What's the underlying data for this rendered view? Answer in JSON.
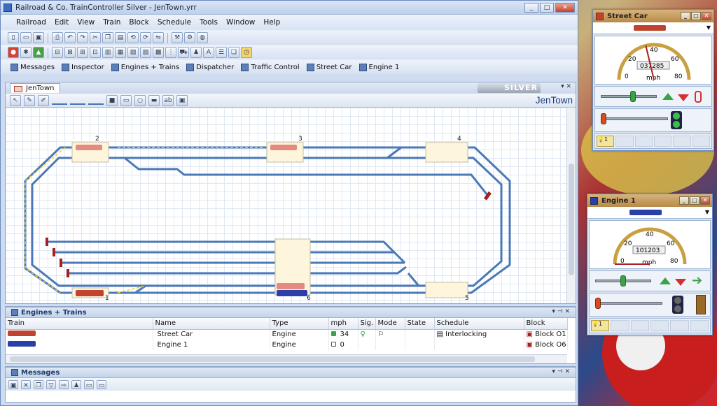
{
  "window": {
    "title": "Railroad & Co. TrainController Silver - JenTown.yrr"
  },
  "menu": [
    "Railroad",
    "Edit",
    "View",
    "Train",
    "Block",
    "Schedule",
    "Tools",
    "Window",
    "Help"
  ],
  "quick_access": [
    "Messages",
    "Inspector",
    "Engines + Trains",
    "Dispatcher",
    "Traffic Control",
    "Street Car",
    "Engine 1"
  ],
  "document": {
    "tab": "JenTown",
    "edition_badge": "SILVER",
    "layout_title": "JenTown",
    "block_labels": [
      "2",
      "3",
      "4",
      "1",
      "6",
      "5"
    ]
  },
  "engines_pane": {
    "title": "Engines + Trains",
    "columns": [
      "Train",
      "Name",
      "Type",
      "mph",
      "Sig.",
      "Mode",
      "State",
      "Schedule",
      "Block"
    ],
    "rows": [
      {
        "name": "Street Car",
        "type": "Engine",
        "mph": "34",
        "schedule": "Interlocking",
        "block": "Block O1",
        "color": "#c0432f"
      },
      {
        "name": "Engine 1",
        "type": "Engine",
        "mph": "0",
        "schedule": "",
        "block": "Block O6",
        "color": "#2a3fa8"
      }
    ]
  },
  "messages_pane": {
    "title": "Messages"
  },
  "streetcar_window": {
    "title": "Street Car",
    "odometer": "037285",
    "unit": "mph",
    "ticks": [
      "0",
      "20",
      "40",
      "60",
      "80"
    ],
    "speed_mph": 34,
    "func_label": "1",
    "color": "#c0432f"
  },
  "engine1_window": {
    "title": "Engine 1",
    "odometer": "101203",
    "unit": "mph",
    "ticks": [
      "0",
      "20",
      "40",
      "60",
      "80"
    ],
    "speed_mph": 0,
    "func_label": "1",
    "color": "#2a3fa8"
  },
  "colors": {
    "track": "#4a78b8",
    "block": "#fdf5dc",
    "accent_red": "#c0432f",
    "accent_blue": "#2a3fa8"
  }
}
